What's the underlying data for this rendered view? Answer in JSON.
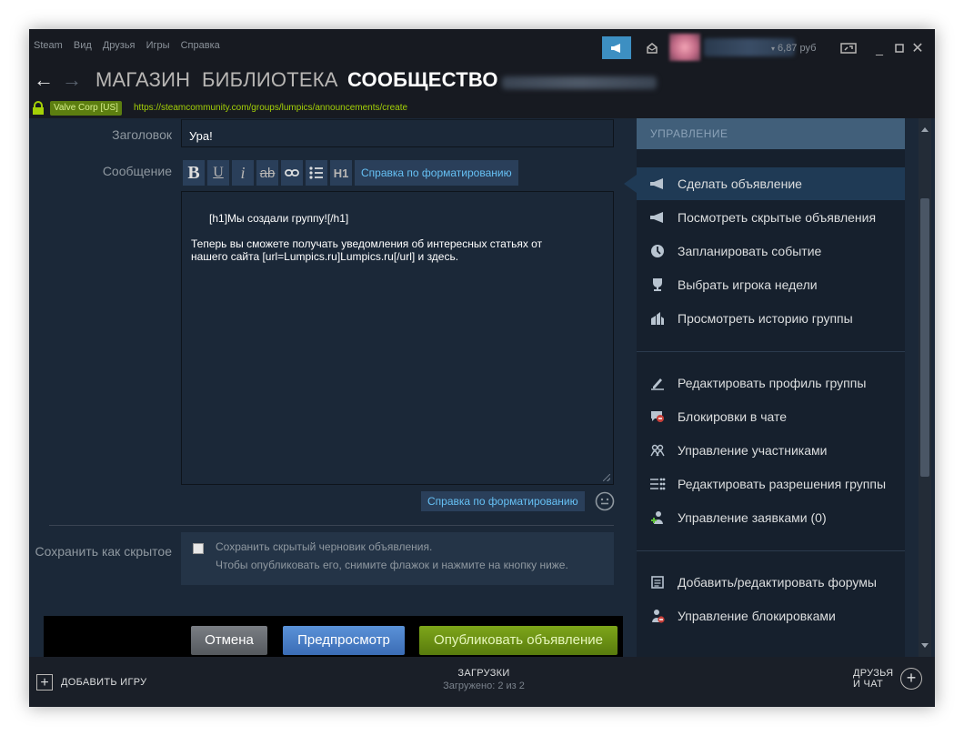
{
  "menu": [
    "Steam",
    "Вид",
    "Друзья",
    "Игры",
    "Справка"
  ],
  "wallet": "6,87 руб",
  "nav": {
    "store": "МАГАЗИН",
    "library": "БИБЛИОТЕКА",
    "community": "СООБЩЕСТВО"
  },
  "urlbar": {
    "cert": "Valve Corp [US]",
    "url": "https://steamcommunity.com/groups/lumpics/announcements/create"
  },
  "form": {
    "title_label": "Заголовок",
    "title_value": "Ура!",
    "message_label": "Сообщение",
    "format_help": "Справка по форматированию",
    "message_value": "[h1]Мы создали группу![/h1]\n\nТеперь вы сможете получать уведомления об интересных статьях от\nнашего сайта [url=Lumpics.ru]Lumpics.ru[/url] и здесь.",
    "format_help_bottom": "Справка по форматированию",
    "save_hidden_label": "Сохранить как скрытое",
    "save_hidden_text1": "Сохранить скрытый черновик объявления.",
    "save_hidden_text2": "Чтобы опубликовать его, снимите флажок и нажмите на кнопку ниже.",
    "cancel": "Отмена",
    "preview": "Предпросмотр",
    "publish": "Опубликовать объявление"
  },
  "panel": {
    "header": "УПРАВЛЕНИЕ",
    "items": [
      {
        "label": "Сделать объявление",
        "icon": "megaphone-icon"
      },
      {
        "label": "Посмотреть скрытые объявления",
        "icon": "megaphone-icon"
      },
      {
        "label": "Запланировать событие",
        "icon": "clock-icon"
      },
      {
        "label": "Выбрать игрока недели",
        "icon": "trophy-icon"
      },
      {
        "label": "Просмотреть историю группы",
        "icon": "history-icon"
      },
      {
        "label": "Редактировать профиль группы",
        "icon": "pencil-icon"
      },
      {
        "label": "Блокировки в чате",
        "icon": "chat-block-icon"
      },
      {
        "label": "Управление участниками",
        "icon": "members-icon"
      },
      {
        "label": "Редактировать разрешения группы",
        "icon": "permissions-icon"
      },
      {
        "label": "Управление заявками (0)",
        "icon": "add-user-icon"
      },
      {
        "label": "Добавить/редактировать форумы",
        "icon": "forum-icon"
      },
      {
        "label": "Управление блокировками",
        "icon": "ban-user-icon"
      }
    ]
  },
  "bottom": {
    "add_game": "ДОБАВИТЬ ИГРУ",
    "downloads": "ЗАГРУЗКИ",
    "downloads_sub": "Загружено: 2 из 2",
    "friends_line1": "ДРУЗЬЯ",
    "friends_line2": "И ЧАТ"
  },
  "colors": {
    "accent_blue": "#66c0f4",
    "publish_green": "#5c7e10",
    "panel_bg": "#16202d"
  }
}
